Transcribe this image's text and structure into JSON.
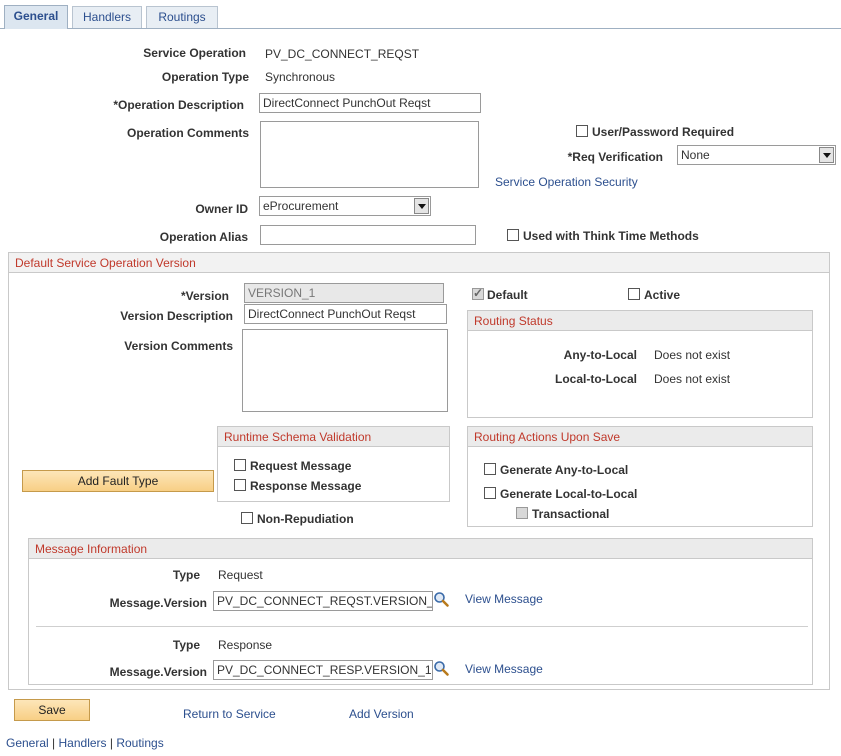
{
  "tabs": [
    {
      "label": "General"
    },
    {
      "label": "Handlers"
    },
    {
      "label": "Routings"
    }
  ],
  "form": {
    "service_operation_label": "Service Operation",
    "service_operation_value": "PV_DC_CONNECT_REQST",
    "operation_type_label": "Operation Type",
    "operation_type_value": "Synchronous",
    "operation_description_label": "*Operation Description",
    "operation_description_value": "DirectConnect PunchOut Reqst",
    "operation_comments_label": "Operation Comments",
    "user_password_label": "User/Password Required",
    "req_verification_label": "*Req Verification",
    "req_verification_value": "None",
    "service_operation_security_link": "Service Operation Security",
    "owner_id_label": "Owner ID",
    "owner_id_value": "eProcurement",
    "operation_alias_label": "Operation Alias",
    "think_time_label": "Used with Think Time Methods"
  },
  "version": {
    "header": "Default Service Operation Version",
    "version_label": "*Version",
    "version_value": "VERSION_1",
    "default_label": "Default",
    "active_label": "Active",
    "version_description_label": "Version Description",
    "version_description_value": "DirectConnect PunchOut Reqst",
    "version_comments_label": "Version Comments",
    "routing_status": {
      "header": "Routing Status",
      "any_to_local_label": "Any-to-Local",
      "any_to_local_value": "Does not exist",
      "local_to_local_label": "Local-to-Local",
      "local_to_local_value": "Does not exist"
    },
    "schema_validation": {
      "header": "Runtime Schema Validation",
      "request_label": "Request Message",
      "response_label": "Response Message"
    },
    "add_fault_type_button": "Add Fault Type",
    "non_repudiation_label": "Non-Repudiation",
    "routing_actions": {
      "header": "Routing Actions Upon Save",
      "generate_any_label": "Generate Any-to-Local",
      "generate_local_label": "Generate Local-to-Local",
      "transactional_label": "Transactional"
    }
  },
  "messages": {
    "header": "Message Information",
    "type_label": "Type",
    "message_version_label": "Message.Version",
    "view_message_link": "View Message",
    "rows": [
      {
        "type": "Request",
        "message_version": "PV_DC_CONNECT_REQST.VERSION_"
      },
      {
        "type": "Response",
        "message_version": "PV_DC_CONNECT_RESP.VERSION_1"
      }
    ]
  },
  "footer": {
    "save_button": "Save",
    "return_link": "Return to Service",
    "add_version_link": "Add Version",
    "nav_general": "General",
    "nav_sep": " | ",
    "nav_handlers": "Handlers",
    "nav_routings": "Routings"
  }
}
